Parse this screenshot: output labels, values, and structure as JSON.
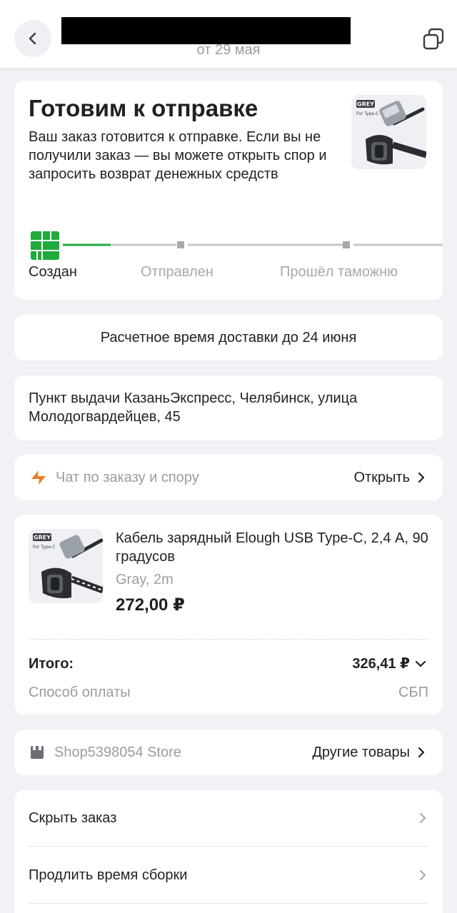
{
  "header": {
    "subtitle": "от 29 мая"
  },
  "status": {
    "title": "Готовим к отправке",
    "description": "Ваш заказ готовится к отправке. Если вы не получили заказ — вы можете открыть спор и запросить возврат денежных средств",
    "thumb_badge": "GREY",
    "thumb_caption": "For Type-C"
  },
  "timeline": {
    "steps": [
      "Создан",
      "Отправлен",
      "Прошёл таможню"
    ],
    "active_index": 0,
    "accent_color": "#1faa3b"
  },
  "eta": {
    "text": "Расчетное время доставки до 24 июня"
  },
  "pickup": {
    "address": "Пункт выдачи КазаньЭкспресс, Челябинск, улица Молодогвардейцев, 45"
  },
  "chat": {
    "label": "Чат по заказу и спору",
    "action": "Открыть"
  },
  "product": {
    "name": "Кабель зарядный Elough USB Type-C, 2,4 А, 90 градусов",
    "variant": "Gray, 2m",
    "price": "272,00 ₽",
    "thumb_badge": "GREY",
    "thumb_caption": "For Type-C"
  },
  "summary": {
    "total_label": "Итого:",
    "total_value": "326,41 ₽",
    "payment_label": "Способ оплаты",
    "payment_value": "СБП"
  },
  "shop": {
    "name": "Shop5398054 Store",
    "action": "Другие товары"
  },
  "menu": {
    "items": [
      "Скрыть заказ",
      "Продлить время сборки"
    ]
  }
}
